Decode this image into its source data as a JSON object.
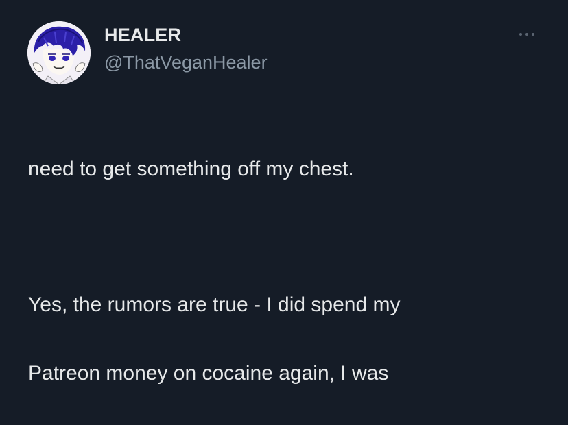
{
  "author": {
    "display_name": "HEALER",
    "handle": "@ThatVeganHealer",
    "avatar_icon": "avatar-anime-portrait"
  },
  "more_icon": "more-horizontal-icon",
  "tweet": {
    "lines": [
      "need to get something off my chest.",
      "Yes, the rumors are true - I did spend my",
      "Patreon money on cocaine again, I was"
    ]
  },
  "colors": {
    "background": "#151c27",
    "text_primary": "#e7e9ea",
    "text_secondary": "#8b98a5"
  }
}
